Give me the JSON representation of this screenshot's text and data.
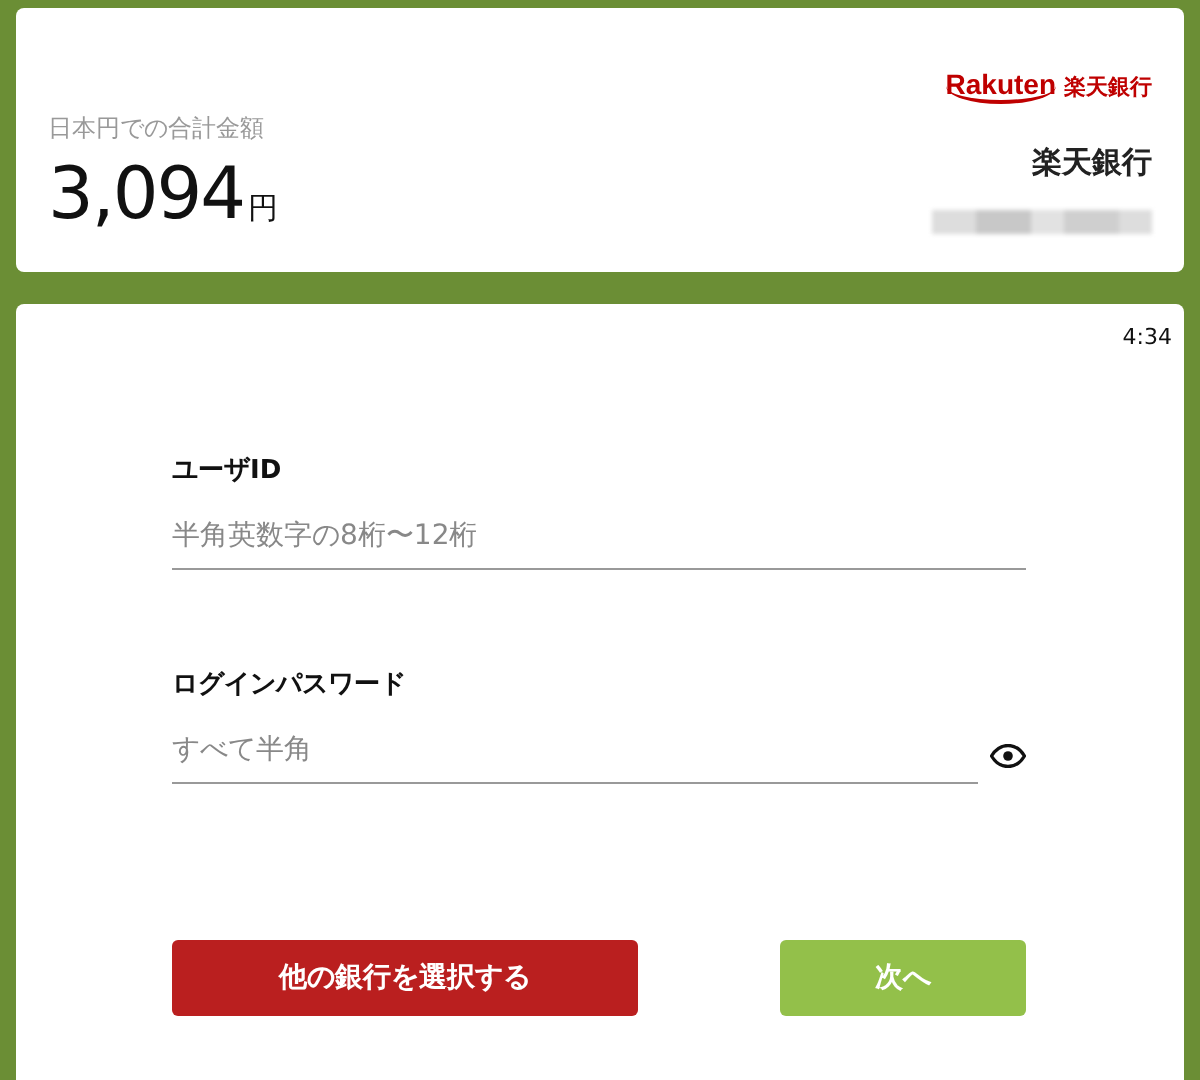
{
  "summary": {
    "label": "日本円での合計金額",
    "amount": "3,094",
    "currency": "円"
  },
  "bank": {
    "logo_latin": "Rakuten",
    "logo_kanji": "楽天銀行",
    "name": "楽天銀行"
  },
  "timer": "4:34",
  "fields": [
    {
      "label": "ユーザID",
      "placeholder": "半角英数字の8桁〜12桁",
      "kind": "text"
    },
    {
      "label": "ログインパスワード",
      "placeholder": "すべて半角",
      "kind": "password"
    }
  ],
  "buttons": [
    {
      "label": "他の銀行を選択する",
      "kind": "secondary"
    },
    {
      "label": "次へ",
      "kind": "primary"
    }
  ]
}
